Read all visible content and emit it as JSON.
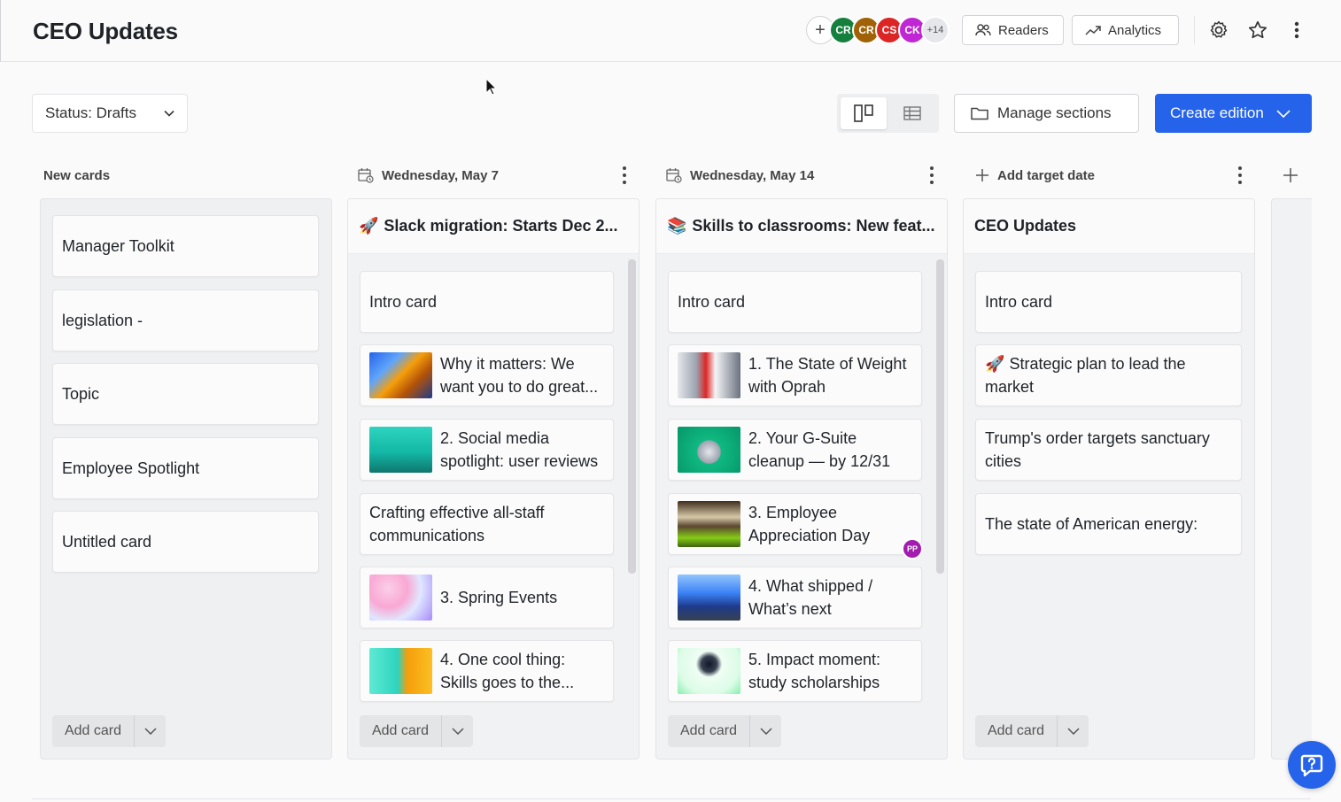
{
  "header": {
    "title": "CEO Updates",
    "avatars": [
      {
        "initials": "CR",
        "color": "#15803d"
      },
      {
        "initials": "CR",
        "color": "#a16207"
      },
      {
        "initials": "CS",
        "color": "#dc2626"
      },
      {
        "initials": "CK",
        "color": "#c026d3"
      }
    ],
    "more_count": "+14",
    "readers_label": "Readers",
    "analytics_label": "Analytics"
  },
  "toolbar": {
    "status_label": "Status: Drafts",
    "manage_sections_label": "Manage sections",
    "create_edition_label": "Create edition"
  },
  "columns": {
    "drafts": {
      "header": "New cards",
      "cards": [
        "Manager Toolkit",
        "legislation -",
        "Topic",
        "Employee Spotlight",
        "Untitled card"
      ],
      "add_label": "Add card"
    },
    "may7": {
      "date": "Wednesday, May 7",
      "emoji": "🚀",
      "title": "Slack migration: Starts Dec 2...",
      "cards": [
        "Intro card",
        "Why it matters: We want you to do great...",
        "2. Social media spotlight: user reviews",
        "Crafting effective all-staff communications",
        "3. Spring Events",
        "4. One cool thing: Skills goes to the..."
      ],
      "add_label": "Add card"
    },
    "may14": {
      "date": "Wednesday, May 14",
      "emoji": "📚",
      "title": "Skills to classrooms: New feat...",
      "cards": [
        "Intro card",
        "1. The State of Weight with Oprah",
        "2. Your G-Suite cleanup — by 12/31",
        "3. Employee Appreciation Day",
        "4. What shipped / What’s next",
        "5. Impact moment: study scholarships"
      ],
      "badge": "PP",
      "add_label": "Add card"
    },
    "target": {
      "add_target_label": "Add target date",
      "title": "CEO Updates",
      "cards": [
        "Intro card",
        "Strategic plan to lead the market",
        "Trump's order targets sanctuary cities",
        "The state of American energy:"
      ],
      "card_emoji": "🚀",
      "add_label": "Add card"
    }
  },
  "colors": {
    "accent": "#2563eb"
  }
}
